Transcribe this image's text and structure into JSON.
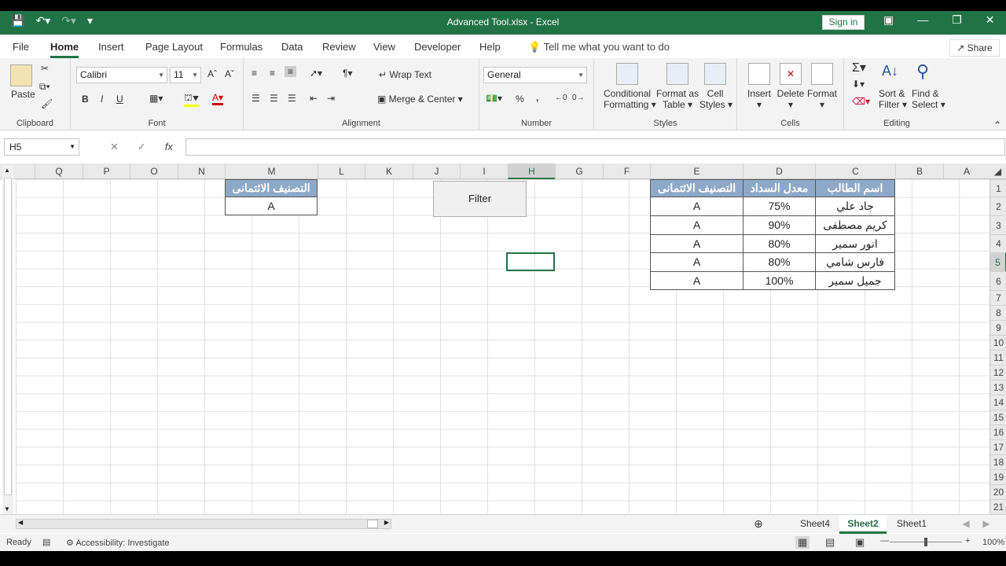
{
  "titlebar": {
    "title": "Advanced Tool.xlsx  -  Excel",
    "signin": "Sign in"
  },
  "tabs": [
    "File",
    "Home",
    "Insert",
    "Page Layout",
    "Formulas",
    "Data",
    "Review",
    "View",
    "Developer",
    "Help"
  ],
  "tellme": "Tell me what you want to do",
  "share": "Share",
  "ribbon": {
    "clipboard": {
      "label": "Clipboard",
      "paste": "Paste"
    },
    "font": {
      "label": "Font",
      "name": "Calibri",
      "size": "11",
      "bold": "B",
      "italic": "I",
      "underline": "U"
    },
    "alignment": {
      "label": "Alignment",
      "wrap": "Wrap Text",
      "merge": "Merge & Center"
    },
    "number": {
      "label": "Number",
      "format": "General",
      "percent": "%",
      "comma": ","
    },
    "styles": {
      "label": "Styles",
      "cond": "Conditional",
      "cond2": "Formatting",
      "fmt": "Format as",
      "fmt2": "Table",
      "cell": "Cell",
      "cell2": "Styles"
    },
    "cells": {
      "label": "Cells",
      "insert": "Insert",
      "delete": "Delete",
      "format": "Format"
    },
    "editing": {
      "label": "Editing",
      "sort": "Sort &",
      "sort2": "Filter",
      "find": "Find &",
      "find2": "Select"
    }
  },
  "formula": {
    "namebox": "H5",
    "value": ""
  },
  "columns": [
    "A",
    "B",
    "C",
    "D",
    "E",
    "F",
    "G",
    "H",
    "I",
    "J",
    "K",
    "L",
    "M",
    "N",
    "O",
    "P",
    "Q"
  ],
  "rows": [
    "1",
    "2",
    "3",
    "4",
    "5",
    "6",
    "7",
    "8",
    "9",
    "10",
    "11",
    "12",
    "13",
    "14",
    "15",
    "16",
    "17",
    "18",
    "19",
    "20",
    "21"
  ],
  "table": {
    "headers": [
      "اسم الطالب",
      "معدل السداد",
      "التصنيف الائتمانى"
    ],
    "rows": [
      [
        "جاد علي",
        "75%",
        "A"
      ],
      [
        "كريم مصطفى",
        "90%",
        "A"
      ],
      [
        "انور سمير",
        "80%",
        "A"
      ],
      [
        "فارس شامي",
        "80%",
        "A"
      ],
      [
        "جميل سمير",
        "100%",
        "A"
      ]
    ]
  },
  "criteria": {
    "header": "التصنيف الائتمانى",
    "value": "A"
  },
  "button": "Filter",
  "sheets": [
    "Sheet4",
    "Sheet2",
    "Sheet1"
  ],
  "status": {
    "ready": "Ready",
    "access": "Accessibility: Investigate",
    "zoom": "100%"
  }
}
